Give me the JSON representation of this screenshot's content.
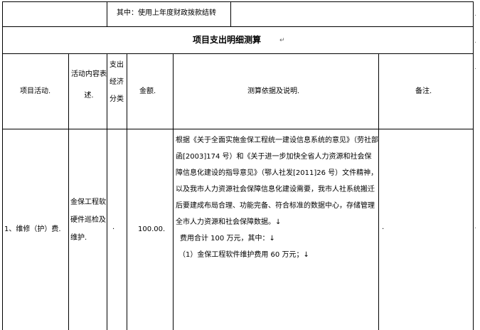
{
  "top_row": {
    "funding_note": "其中：使用上年度财政拨款结转"
  },
  "table": {
    "title": "项目支出明细测算",
    "headers": {
      "activity": "项目活动.",
      "content": "活动内容表述.",
      "category": "支出经济分类",
      "amount": "金额.",
      "basis": "测算依据及说明.",
      "remark": "备注."
    },
    "row": {
      "activity": "1、维修（护）费.",
      "content": "金保工程软硬件巡检及维护.",
      "category": ".",
      "amount": "100.00.",
      "basis_lines": [
        "根据《关于全面实施金保工程统一建设信息系统的意见》（劳社部函[2003]174 号）和《关于进一步加快全省人力资源和社会保障信息化建设的指导意见》（鄂人社发[2011]26 号）文件精神，以及我市人力资源社会保障信息化建设需要，我市人社系统搬迁后要建成布局合理、功能完备、符合标准的数据中心，存储管理全市人力资源和社会保障数据。↓",
        "费用合计 100 万元，其中：↓",
        "（1）金保工程软件维护费用 60 万元；↓"
      ],
      "remark": "."
    }
  },
  "marks": {
    "cell_end": ".",
    "para_mark": "↵"
  }
}
